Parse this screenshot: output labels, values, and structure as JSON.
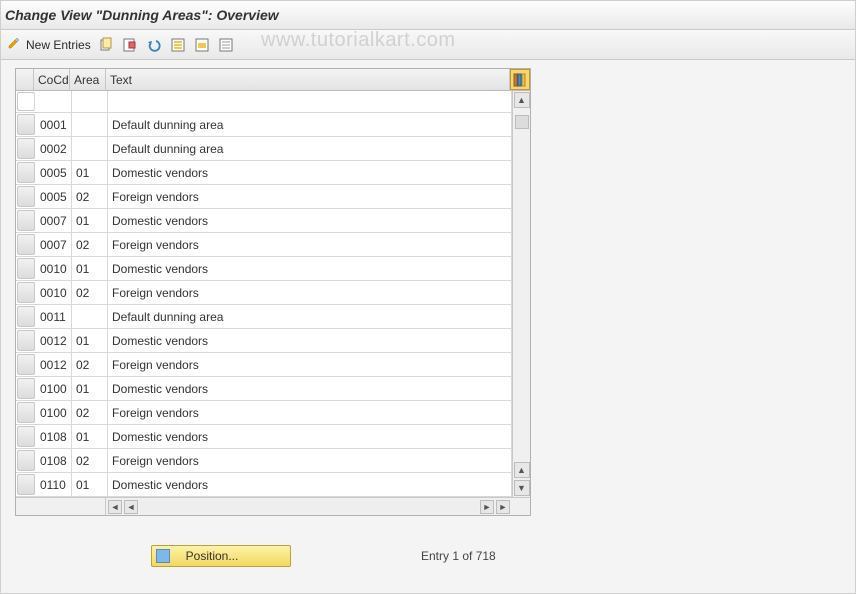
{
  "title": "Change View \"Dunning Areas\": Overview",
  "watermark": "www.tutorialkart.com",
  "toolbar": {
    "new_entries_label": "New Entries"
  },
  "columns": {
    "cocd": "CoCd",
    "area": "Area",
    "text": "Text"
  },
  "rows": [
    {
      "cocd": "0001",
      "area": "",
      "text": "Default dunning area"
    },
    {
      "cocd": "0002",
      "area": "",
      "text": "Default dunning area"
    },
    {
      "cocd": "0005",
      "area": "01",
      "text": "Domestic vendors"
    },
    {
      "cocd": "0005",
      "area": "02",
      "text": "Foreign vendors"
    },
    {
      "cocd": "0007",
      "area": "01",
      "text": "Domestic vendors"
    },
    {
      "cocd": "0007",
      "area": "02",
      "text": "Foreign vendors"
    },
    {
      "cocd": "0010",
      "area": "01",
      "text": "Domestic vendors"
    },
    {
      "cocd": "0010",
      "area": "02",
      "text": "Foreign vendors"
    },
    {
      "cocd": "0011",
      "area": "",
      "text": "Default dunning area"
    },
    {
      "cocd": "0012",
      "area": "01",
      "text": "Domestic vendors"
    },
    {
      "cocd": "0012",
      "area": "02",
      "text": "Foreign vendors"
    },
    {
      "cocd": "0100",
      "area": "01",
      "text": "Domestic vendors"
    },
    {
      "cocd": "0100",
      "area": "02",
      "text": "Foreign vendors"
    },
    {
      "cocd": "0108",
      "area": "01",
      "text": "Domestic vendors"
    },
    {
      "cocd": "0108",
      "area": "02",
      "text": "Foreign vendors"
    },
    {
      "cocd": "0110",
      "area": "01",
      "text": "Domestic vendors"
    }
  ],
  "footer": {
    "position_label": "Position...",
    "entry_status": "Entry 1 of 718"
  }
}
